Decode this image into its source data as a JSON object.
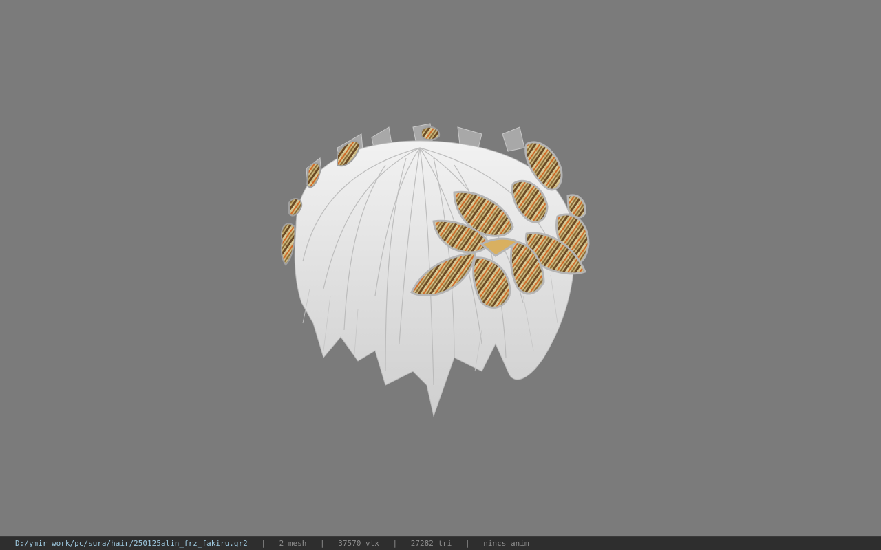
{
  "viewport": {
    "background": "#7b7b7b",
    "model_name": "hair-model-with-leaf-crown"
  },
  "statusbar": {
    "path": "D:/ymir work/pc/sura/hair/250125alin_frz_fakiru.gr2",
    "separator": "|",
    "mesh": "2 mesh",
    "vertices": "37570 vtx",
    "triangles": "27282 tri",
    "animation": "nincs anim"
  },
  "colors": {
    "hair": "#e8e8e8",
    "leaf_gold": "#d9c58a",
    "leaf_stripe": "#6b4a25",
    "leaf_orange": "#d06a28"
  }
}
